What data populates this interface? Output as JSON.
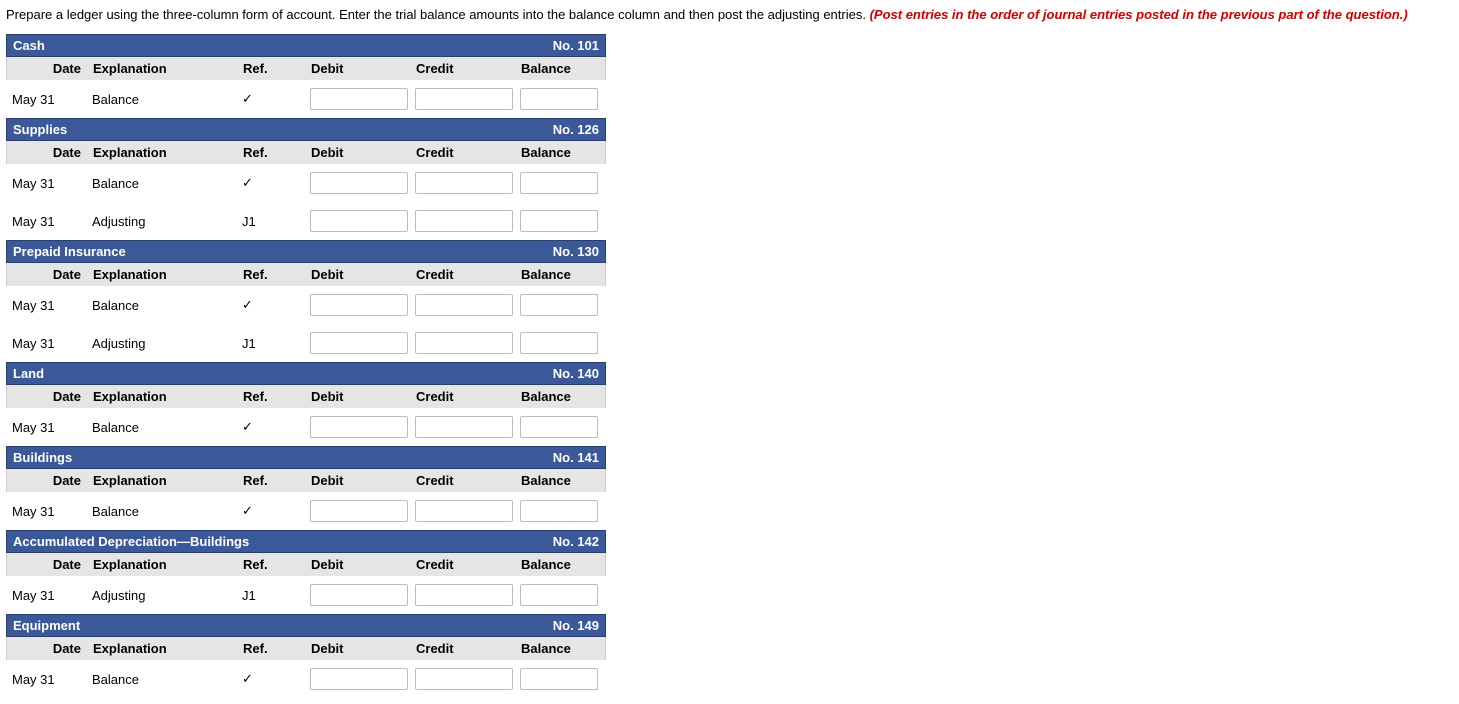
{
  "instructions": {
    "main": "Prepare a ledger using the three-column form of account. Enter the trial balance amounts into the balance column and then post the adjusting entries. ",
    "emph": "(Post entries in the order of journal entries posted in the previous part of the question.)"
  },
  "headers": {
    "date": "Date",
    "explanation": "Explanation",
    "ref": "Ref.",
    "debit": "Debit",
    "credit": "Credit",
    "balance": "Balance"
  },
  "no_label_prefix": "No. ",
  "accounts": [
    {
      "name": "Cash",
      "no": "101",
      "rows": [
        {
          "date": "May 31",
          "explanation": "Balance",
          "ref": "✓",
          "debit": "",
          "credit": "",
          "balance": ""
        }
      ]
    },
    {
      "name": "Supplies",
      "no": "126",
      "rows": [
        {
          "date": "May 31",
          "explanation": "Balance",
          "ref": "✓",
          "debit": "",
          "credit": "",
          "balance": ""
        },
        {
          "date": "May 31",
          "explanation": "Adjusting",
          "ref": "J1",
          "debit": "",
          "credit": "",
          "balance": ""
        }
      ]
    },
    {
      "name": "Prepaid Insurance",
      "no": "130",
      "rows": [
        {
          "date": "May 31",
          "explanation": "Balance",
          "ref": "✓",
          "debit": "",
          "credit": "",
          "balance": ""
        },
        {
          "date": "May 31",
          "explanation": "Adjusting",
          "ref": "J1",
          "debit": "",
          "credit": "",
          "balance": ""
        }
      ]
    },
    {
      "name": "Land",
      "no": "140",
      "rows": [
        {
          "date": "May 31",
          "explanation": "Balance",
          "ref": "✓",
          "debit": "",
          "credit": "",
          "balance": ""
        }
      ]
    },
    {
      "name": "Buildings",
      "no": "141",
      "rows": [
        {
          "date": "May 31",
          "explanation": "Balance",
          "ref": "✓",
          "debit": "",
          "credit": "",
          "balance": ""
        }
      ]
    },
    {
      "name": "Accumulated Depreciation—Buildings",
      "no": "142",
      "rows": [
        {
          "date": "May 31",
          "explanation": "Adjusting",
          "ref": "J1",
          "debit": "",
          "credit": "",
          "balance": ""
        }
      ]
    },
    {
      "name": "Equipment",
      "no": "149",
      "rows": [
        {
          "date": "May 31",
          "explanation": "Balance",
          "ref": "✓",
          "debit": "",
          "credit": "",
          "balance": ""
        }
      ]
    }
  ]
}
